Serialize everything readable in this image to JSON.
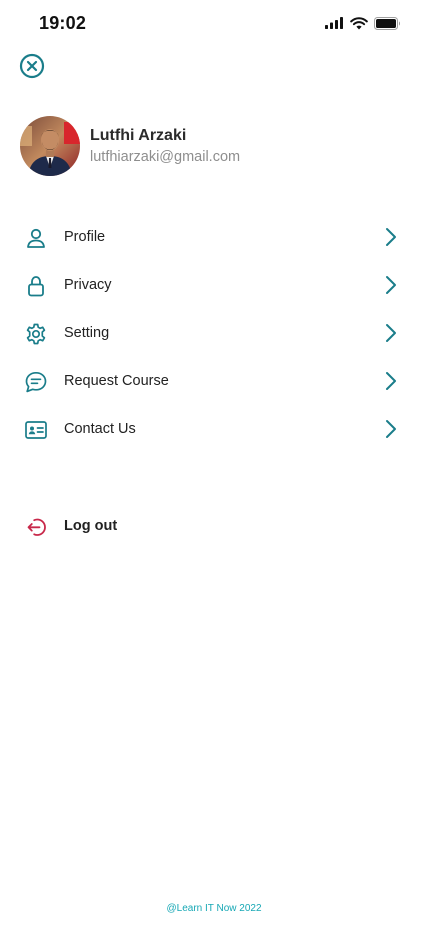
{
  "status_bar": {
    "time": "19:02",
    "icons": [
      "cellular-signal-icon",
      "wifi-icon",
      "battery-icon"
    ]
  },
  "close_icon": "close-circle-icon",
  "profile": {
    "name": "Lutfhi Arzaki",
    "email": "lutfhiarzaki@gmail.com"
  },
  "menu": {
    "items": [
      {
        "label": "Profile",
        "icon": "user-icon"
      },
      {
        "label": "Privacy",
        "icon": "lock-icon"
      },
      {
        "label": "Setting",
        "icon": "gear-icon"
      },
      {
        "label": "Request Course",
        "icon": "chat-bubble-icon"
      },
      {
        "label": "Contact Us",
        "icon": "contact-card-icon"
      }
    ]
  },
  "logout": {
    "label": "Log out",
    "icon": "logout-icon"
  },
  "footer": {
    "text": "@Learn IT Now 2022"
  },
  "colors": {
    "accent": "#1a7d8a",
    "logout": "#c8284a",
    "footer": "#17a8b5"
  }
}
